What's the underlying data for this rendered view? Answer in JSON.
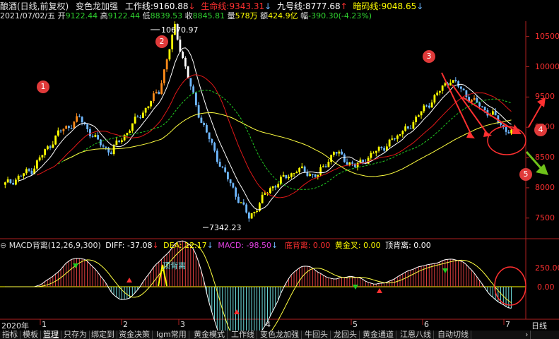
{
  "header": {
    "stock_name": "酿酒(日线,前复权)",
    "indicator_name": "变色龙加强",
    "work_line_label": "工作线:",
    "work_line_value": "9160.88",
    "life_line_label": "生命线:",
    "life_line_value": "9343.31",
    "nine_line_label": "九号线:",
    "nine_line_value": "8777.68",
    "chip_line_label": "暗码线:",
    "chip_line_value": "9048.65"
  },
  "quote": {
    "date": "2021/07/02/五",
    "open_label": "开",
    "open": "9122.44",
    "high_label": "高",
    "high": "9122.44",
    "low_label": "低",
    "low": "8839.53",
    "close_label": "收",
    "close": "8845.81",
    "vol_label": "量",
    "vol": "578万",
    "amount_label": "额",
    "amount": "424.9亿",
    "change_label": "幅",
    "change": "-390.30(-4.23%)"
  },
  "price_axis": [
    "10500",
    "10000",
    "9500",
    "9000",
    "8500",
    "8000",
    "7500"
  ],
  "macd_axis": [
    "250.00",
    "0.00"
  ],
  "annotations": {
    "high_price": "10670.97",
    "low_price": "7342.23",
    "top_divergence_text": "顶背离"
  },
  "markers": [
    "1",
    "2",
    "3",
    "4",
    "5"
  ],
  "macd_header": {
    "title": "MACD背离(12,26,9,300)",
    "diff": "DIFF: -37.08",
    "dea": "DEA: 12.17",
    "macd": "MACD: -98.50",
    "bottom_div": "底背离: 0.00",
    "golden": "黄金叉: 0.00",
    "top_div": "顶背离: 0.00"
  },
  "time_axis": {
    "year": "2020年",
    "months": [
      "1",
      "2",
      "3",
      "4",
      "5",
      "6",
      "7"
    ]
  },
  "period_label": "日线",
  "tabs": [
    "指标",
    "模板",
    "管理",
    "只存为",
    "绑定到",
    "资金决策",
    "lgm常用",
    "黄金模式",
    "工作线",
    "变色龙加强",
    "牛回头",
    "龙回头",
    "黄金通道",
    "江恩八线",
    "自动切线"
  ],
  "active_tab": 2,
  "colors": {
    "up_yellow": "#ffff00",
    "up_orange": "#ff8c1a",
    "down_blue": "#6fb8ff",
    "down_white": "#ffffff",
    "line_white": "#ffffff",
    "line_red": "#e01818",
    "line_green": "#22cc22",
    "line_yellow": "#ffff40",
    "axis_red": "#ff3030",
    "arrow_red": "#ff3030",
    "arrow_green": "#6fc21a"
  }
}
